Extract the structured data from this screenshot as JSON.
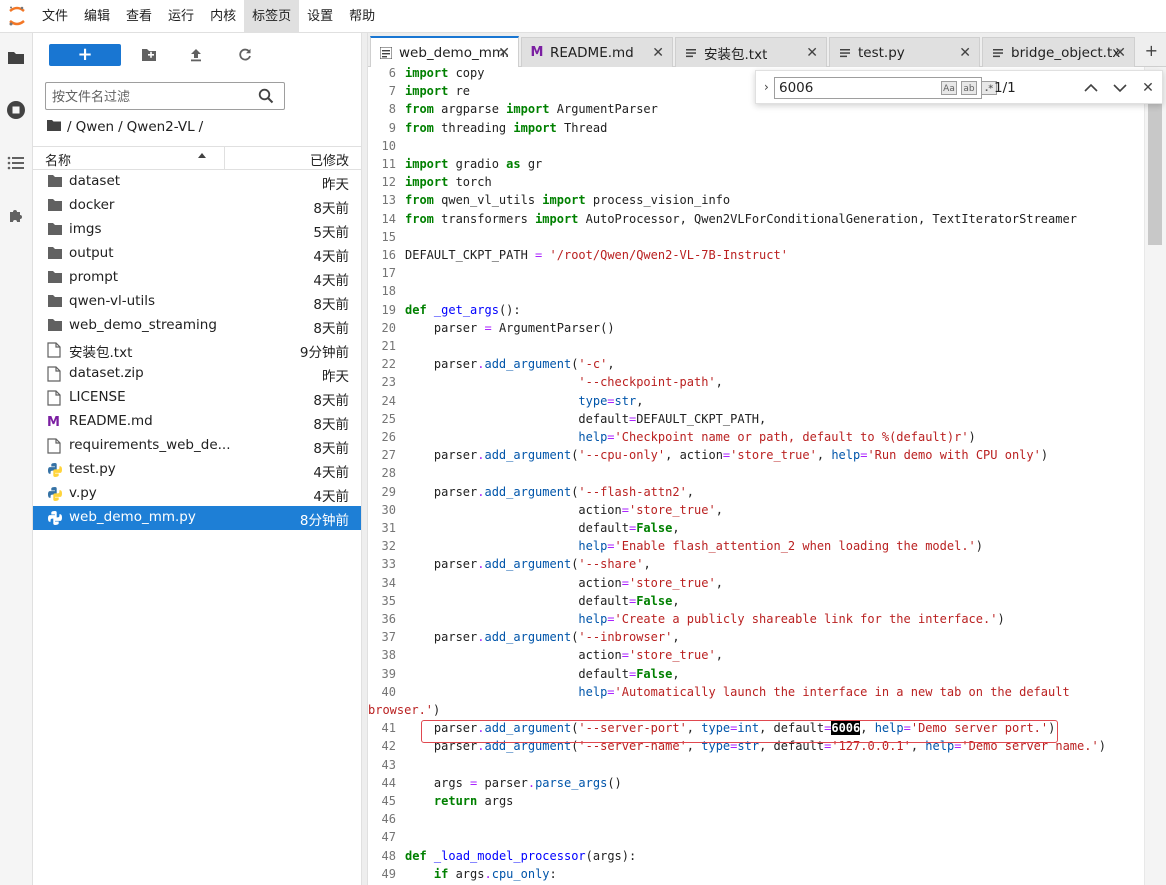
{
  "menubar": {
    "items": [
      "文件",
      "编辑",
      "查看",
      "运行",
      "内核",
      "标签页",
      "设置",
      "帮助"
    ],
    "active_index": 5
  },
  "filebrowser": {
    "new_button": "+",
    "filter_placeholder": "按文件名过滤",
    "breadcrumb": [
      "/",
      "Qwen",
      "/",
      "Qwen2-VL",
      "/"
    ],
    "header_name": "名称",
    "header_modified": "已修改",
    "files": [
      {
        "name": "dataset",
        "date": "昨天",
        "type": "folder"
      },
      {
        "name": "docker",
        "date": "8天前",
        "type": "folder"
      },
      {
        "name": "imgs",
        "date": "5天前",
        "type": "folder"
      },
      {
        "name": "output",
        "date": "4天前",
        "type": "folder"
      },
      {
        "name": "prompt",
        "date": "4天前",
        "type": "folder"
      },
      {
        "name": "qwen-vl-utils",
        "date": "8天前",
        "type": "folder"
      },
      {
        "name": "web_demo_streaming",
        "date": "8天前",
        "type": "folder"
      },
      {
        "name": "安装包.txt",
        "date": "9分钟前",
        "type": "file"
      },
      {
        "name": "dataset.zip",
        "date": "昨天",
        "type": "file"
      },
      {
        "name": "LICENSE",
        "date": "8天前",
        "type": "file"
      },
      {
        "name": "README.md",
        "date": "8天前",
        "type": "markdown"
      },
      {
        "name": "requirements_web_de...",
        "date": "8天前",
        "type": "file"
      },
      {
        "name": "test.py",
        "date": "4天前",
        "type": "python"
      },
      {
        "name": "v.py",
        "date": "4天前",
        "type": "python"
      },
      {
        "name": "web_demo_mm.py",
        "date": "8分钟前",
        "type": "python",
        "selected": true
      }
    ]
  },
  "tabs": [
    {
      "label": "web_demo_mm.",
      "icon": "python-icon",
      "active": true
    },
    {
      "label": "README.md",
      "icon": "markdown-icon",
      "active": false
    },
    {
      "label": "安装包.txt",
      "icon": "file-icon",
      "active": false
    },
    {
      "label": "test.py",
      "icon": "file-icon",
      "active": false
    },
    {
      "label": "bridge_object.txt",
      "icon": "file-icon",
      "active": false
    }
  ],
  "tab_add": "+",
  "find": {
    "query": "6006",
    "count": "1/1",
    "opt_case": "Aa",
    "opt_word": "ab",
    "opt_regex": ".*"
  },
  "code_lines": [
    {
      "n": "6",
      "html": "<span class='kw'>import</span> copy"
    },
    {
      "n": "7",
      "html": "<span class='kw'>import</span> re"
    },
    {
      "n": "8",
      "html": "<span class='kw'>from</span> argparse <span class='kw'>import</span> ArgumentParser"
    },
    {
      "n": "9",
      "html": "<span class='kw'>from</span> threading <span class='kw'>import</span> Thread"
    },
    {
      "n": "10",
      "html": ""
    },
    {
      "n": "11",
      "html": "<span class='kw'>import</span> gradio <span class='kw'>as</span> gr"
    },
    {
      "n": "12",
      "html": "<span class='kw'>import</span> torch"
    },
    {
      "n": "13",
      "html": "<span class='kw'>from</span> qwen_vl_utils <span class='kw'>import</span> process_vision_info"
    },
    {
      "n": "14",
      "html": "<span class='kw'>from</span> transformers <span class='kw'>import</span> AutoProcessor, Qwen2VLForConditionalGeneration, TextIteratorStreamer"
    },
    {
      "n": "15",
      "html": ""
    },
    {
      "n": "16",
      "html": "DEFAULT_CKPT_PATH <span class='op'>=</span> <span class='str'>'/root/Qwen/Qwen2-VL-7B-Instruct'</span>"
    },
    {
      "n": "17",
      "html": ""
    },
    {
      "n": "18",
      "html": ""
    },
    {
      "n": "19",
      "html": "<span class='kw'>def</span> <span class='fn'>_get_args</span>():"
    },
    {
      "n": "20",
      "html": "    parser <span class='op'>=</span> ArgumentParser()"
    },
    {
      "n": "21",
      "html": ""
    },
    {
      "n": "22",
      "html": "    parser<span class='op'>.</span><span class='attr'>add_argument</span>(<span class='str'>'-c'</span>,"
    },
    {
      "n": "23",
      "html": "                        <span class='str'>'--checkpoint-path'</span>,"
    },
    {
      "n": "24",
      "html": "                        <span class='attr'>type</span><span class='op'>=</span><span class='attr'>str</span>,"
    },
    {
      "n": "25",
      "html": "                        default<span class='op'>=</span>DEFAULT_CKPT_PATH,"
    },
    {
      "n": "26",
      "html": "                        <span class='attr'>help</span><span class='op'>=</span><span class='str'>'Checkpoint name or path, default to %(default)r'</span>)"
    },
    {
      "n": "27",
      "html": "    parser<span class='op'>.</span><span class='attr'>add_argument</span>(<span class='str'>'--cpu-only'</span>, action<span class='op'>=</span><span class='str'>'store_true'</span>, <span class='attr'>help</span><span class='op'>=</span><span class='str'>'Run demo with CPU only'</span>)"
    },
    {
      "n": "28",
      "html": ""
    },
    {
      "n": "29",
      "html": "    parser<span class='op'>.</span><span class='attr'>add_argument</span>(<span class='str'>'--flash-attn2'</span>,"
    },
    {
      "n": "30",
      "html": "                        action<span class='op'>=</span><span class='str'>'store_true'</span>,"
    },
    {
      "n": "31",
      "html": "                        default<span class='op'>=</span><span class='kw'>False</span>,"
    },
    {
      "n": "32",
      "html": "                        <span class='attr'>help</span><span class='op'>=</span><span class='str'>'Enable flash_attention_2 when loading the model.'</span>)"
    },
    {
      "n": "33",
      "html": "    parser<span class='op'>.</span><span class='attr'>add_argument</span>(<span class='str'>'--share'</span>,"
    },
    {
      "n": "34",
      "html": "                        action<span class='op'>=</span><span class='str'>'store_true'</span>,"
    },
    {
      "n": "35",
      "html": "                        default<span class='op'>=</span><span class='kw'>False</span>,"
    },
    {
      "n": "36",
      "html": "                        <span class='attr'>help</span><span class='op'>=</span><span class='str'>'Create a publicly shareable link for the interface.'</span>)"
    },
    {
      "n": "37",
      "html": "    parser<span class='op'>.</span><span class='attr'>add_argument</span>(<span class='str'>'--inbrowser'</span>,"
    },
    {
      "n": "38",
      "html": "                        action<span class='op'>=</span><span class='str'>'store_true'</span>,"
    },
    {
      "n": "39",
      "html": "                        default<span class='op'>=</span><span class='kw'>False</span>,"
    },
    {
      "n": "40",
      "html": "                        <span class='attr'>help</span><span class='op'>=</span><span class='str'>'Automatically launch the interface in a new tab on the default</span>"
    },
    {
      "n": "",
      "html": "<span class='str'>browser.'</span>)"
    },
    {
      "n": "41",
      "html": "    parser<span class='op'>.</span><span class='attr'>add_argument</span>(<span class='str'>'--server-port'</span>, <span class='attr'>type</span><span class='op'>=</span><span class='attr'>int</span>, default<span class='op'>=</span><span class='hl'>6006</span>, <span class='attr'>help</span><span class='op'>=</span><span class='str'>'Demo server port.'</span>)"
    },
    {
      "n": "42",
      "html": "    parser<span class='op'>.</span><span class='attr'>add_argument</span>(<span class='str'>'--server-name'</span>, <span class='attr'>type</span><span class='op'>=</span><span class='attr'>str</span>, default<span class='op'>=</span><span class='str'>'127.0.0.1'</span>, <span class='attr'>help</span><span class='op'>=</span><span class='str'>'Demo server name.'</span>)"
    },
    {
      "n": "43",
      "html": ""
    },
    {
      "n": "44",
      "html": "    args <span class='op'>=</span> parser<span class='op'>.</span><span class='attr'>parse_args</span>()"
    },
    {
      "n": "45",
      "html": "    <span class='kw'>return</span> args"
    },
    {
      "n": "46",
      "html": ""
    },
    {
      "n": "47",
      "html": ""
    },
    {
      "n": "48",
      "html": "<span class='kw'>def</span> <span class='fn'>_load_model_processor</span>(args):"
    },
    {
      "n": "49",
      "html": "    <span class='kw'>if</span> args<span class='op'>.</span><span class='attr'>cpu_only</span>:"
    }
  ],
  "colors": {
    "accent": "#1976d2",
    "selected_row": "#1e7fd6",
    "highlight_box": "#e0484f"
  }
}
